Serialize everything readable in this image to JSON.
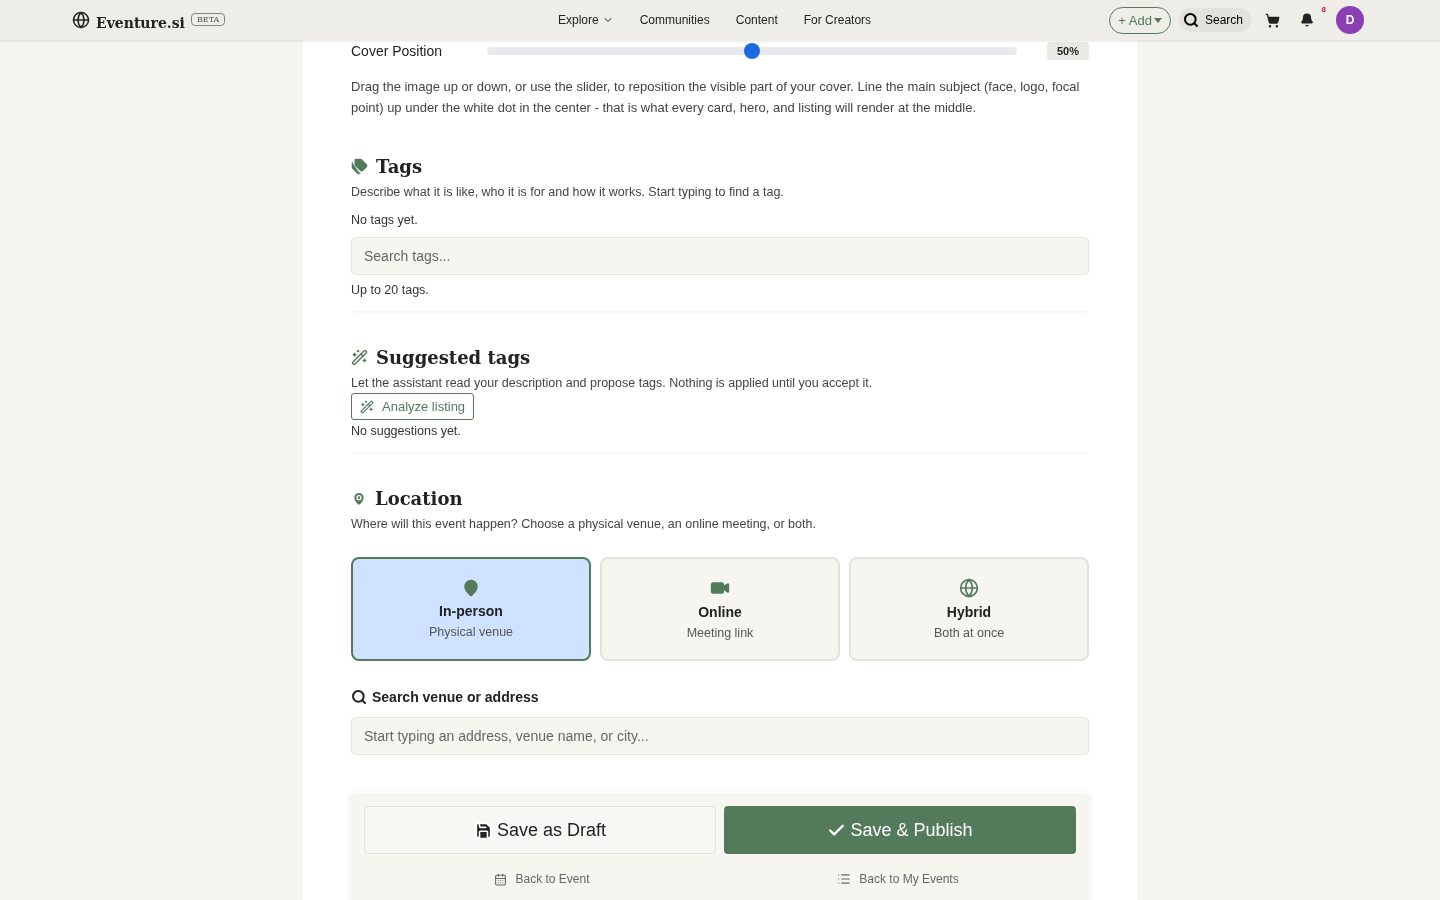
{
  "header": {
    "logo": "Eventure.si",
    "badge": "BETA",
    "nav": [
      {
        "label": "Explore",
        "dropdown": true
      },
      {
        "label": "Communities",
        "dropdown": false
      },
      {
        "label": "Content",
        "dropdown": false
      },
      {
        "label": "For Creators",
        "dropdown": false
      }
    ],
    "add_button": "+ Add",
    "search_button": "Search",
    "notifications": "8",
    "avatar": "D"
  },
  "cover": {
    "label": "Cover Position",
    "level": 0.5,
    "reading": "50%",
    "help": "Drag the image up or down, or use the slider, to reposition the visible part of your cover. Line the main subject (face, logo, focal point) up under the white dot in the center - that is what every card, hero, and listing will render at the middle."
  },
  "tags": {
    "title": "Tags",
    "description": "Describe what it is like, who it is for and how it works. Start typing to find a tag.",
    "empty": "No tags yet.",
    "search": {
      "placeholder": "Search tags..."
    },
    "hint": "Up to 20 tags."
  },
  "suggested": {
    "title": "Suggested tags",
    "description": "Let the assistant read your description and propose tags. Nothing is applied until you accept it.",
    "button": "Analyze listing",
    "empty": "No suggestions yet."
  },
  "location": {
    "title": "Location",
    "description": "Where will this event happen? Choose a physical venue, an online meeting, or both.",
    "options": [
      {
        "kind": "pin",
        "title": "In-person",
        "subtitle": "Physical venue",
        "selected": true
      },
      {
        "kind": "video",
        "title": "Online",
        "subtitle": "Meeting link",
        "selected": false
      },
      {
        "kind": "globe",
        "title": "Hybrid",
        "subtitle": "Both at once",
        "selected": false
      }
    ],
    "venue_label": "Search venue or address",
    "venue": {
      "placeholder": "Start typing an address, venue name, or city..."
    }
  },
  "actions": {
    "draft": "Save as Draft",
    "publish": "Save & Publish",
    "links": [
      {
        "kind": "calendar",
        "label": "Back to Event"
      },
      {
        "kind": "list",
        "label": "Back to My Events"
      }
    ]
  }
}
